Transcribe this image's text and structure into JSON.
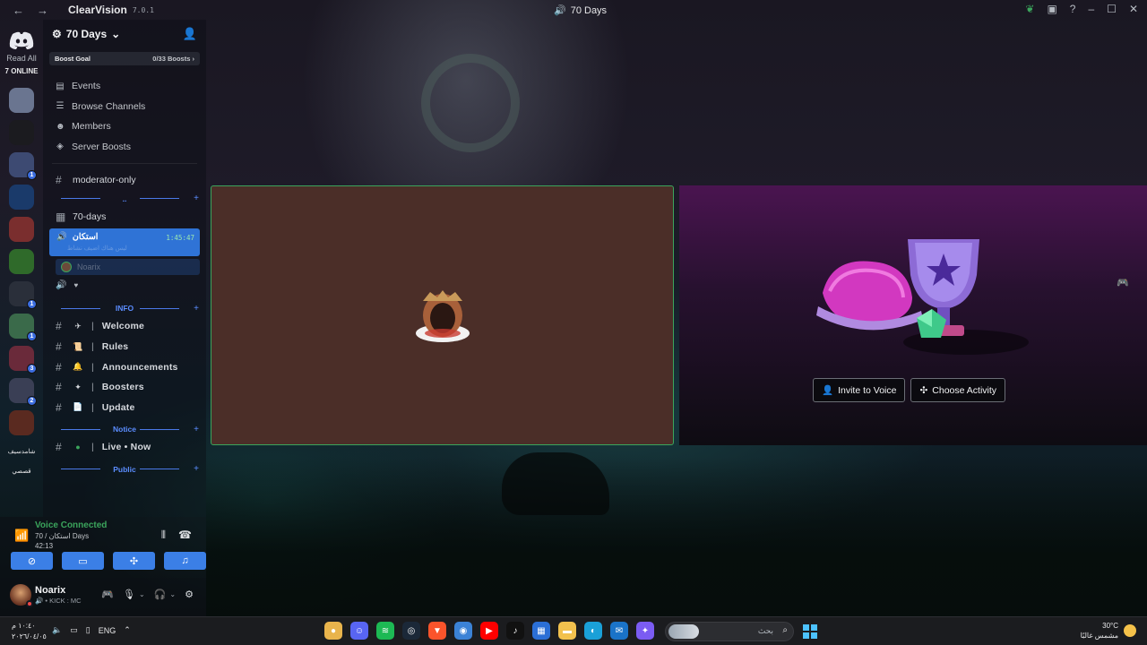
{
  "titlebar": {
    "app_name": "ClearVision",
    "app_version": "7.0.1",
    "window_title": "70 Days"
  },
  "rail": {
    "read_all": "Read All",
    "online": "7 ONLINE",
    "servers": [
      {
        "color": "#6a7590",
        "badge": ""
      },
      {
        "color": "#1b1b1f",
        "badge": ""
      },
      {
        "color": "#3d4a72",
        "badge": "1"
      },
      {
        "color": "#1a3a6a",
        "badge": ""
      },
      {
        "color": "#7a2e2e",
        "badge": ""
      },
      {
        "color": "#2f6a2a",
        "badge": ""
      },
      {
        "color": "#2a2f3a",
        "badge": "1"
      },
      {
        "color": "#3a6a4a",
        "badge": "1"
      },
      {
        "color": "#6a2a3a",
        "badge": "3"
      },
      {
        "color": "#3a3f55",
        "badge": "2"
      },
      {
        "color": "#5a2a20",
        "badge": ""
      }
    ],
    "text_items": [
      "شامدسيف",
      "قصصي"
    ]
  },
  "sidebar": {
    "server_name": "70 Days",
    "boost_goal": "Boost Goal",
    "boost_count": "0/33 Boosts",
    "nav": [
      {
        "label": "Events",
        "icon": "▤"
      },
      {
        "label": "Browse Channels",
        "icon": "☰"
      },
      {
        "label": "Members",
        "icon": "☻"
      },
      {
        "label": "Server Boosts",
        "icon": "◈"
      }
    ],
    "moderator_channel": "moderator-only",
    "days_channel": "70-days",
    "voice_channel": {
      "name": "استكان",
      "time": "1:45:47",
      "subtitle": "ليس هناك اضيف نشاط",
      "user": "Noarix"
    },
    "categories": {
      "info": "INFO",
      "notice": "Notice",
      "public": "Public"
    },
    "info_channels": [
      {
        "emoji": "✈",
        "label": "Welcome"
      },
      {
        "emoji": "📜",
        "label": "Rules"
      },
      {
        "emoji": "🔔",
        "label": "Announcements"
      },
      {
        "emoji": "✦",
        "label": "Boosters"
      },
      {
        "emoji": "📄",
        "label": "Update"
      }
    ],
    "notice_channels": [
      {
        "emoji": "●",
        "label": "Live • Now"
      }
    ]
  },
  "voice_panel": {
    "status": "Voice Connected",
    "channel": "70 / استكان Days",
    "timer": "42:13"
  },
  "user_panel": {
    "name": "Noarix",
    "activity": "KICK : MC"
  },
  "stage": {
    "left_tile_color": "#4b2e28",
    "invite_label": "Invite to Voice",
    "activity_label": "Choose Activity"
  },
  "taskbar": {
    "time": "١٠:٤٠ م",
    "date": "٢٠٢٦/٠٤/٠٥",
    "lang": "ENG",
    "search_placeholder": "بحث",
    "temperature": "30°C",
    "weather": "مشمس غالبًا"
  },
  "colors": {
    "accent": "#3b7fe6",
    "connected_green": "#3ba55c",
    "category_blue": "#5b8dff"
  }
}
